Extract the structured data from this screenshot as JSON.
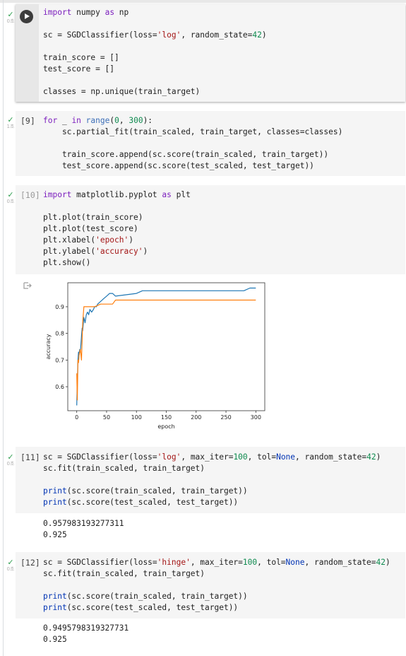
{
  "cells": [
    {
      "exec_label": "",
      "duration": "0초",
      "code_lines": [
        [
          [
            "k",
            "import"
          ],
          [
            "t",
            " numpy "
          ],
          [
            "k",
            "as"
          ],
          [
            "t",
            " np"
          ]
        ],
        [],
        [
          [
            "t",
            "sc = SGDClassifier(loss="
          ],
          [
            "s",
            "'log'"
          ],
          [
            "t",
            ", random_state="
          ],
          [
            "n",
            "42"
          ],
          [
            "t",
            ")"
          ]
        ],
        [],
        [
          [
            "t",
            "train_score = []"
          ]
        ],
        [
          [
            "t",
            "test_score = []"
          ]
        ],
        [],
        [
          [
            "t",
            "classes = np.unique(train_target)"
          ]
        ]
      ]
    },
    {
      "exec_label": "[9]",
      "duration": "1초",
      "code_lines": [
        [
          [
            "k",
            "for"
          ],
          [
            "t",
            " _ "
          ],
          [
            "k",
            "in"
          ],
          [
            "t",
            " "
          ],
          [
            "f",
            "range"
          ],
          [
            "t",
            "("
          ],
          [
            "n",
            "0"
          ],
          [
            "t",
            ", "
          ],
          [
            "n",
            "300"
          ],
          [
            "t",
            "):"
          ]
        ],
        [
          [
            "t",
            "    sc.partial_fit(train_scaled, train_target, classes=classes)"
          ]
        ],
        [],
        [
          [
            "t",
            "    train_score.append(sc.score(train_scaled, train_target))"
          ]
        ],
        [
          [
            "t",
            "    test_score.append(sc.score(test_scaled, test_target))"
          ]
        ]
      ]
    },
    {
      "exec_label": "[10]",
      "duration": "0초",
      "code_lines": [
        [
          [
            "k",
            "import"
          ],
          [
            "t",
            " matplotlib.pyplot "
          ],
          [
            "k",
            "as"
          ],
          [
            "t",
            " plt"
          ]
        ],
        [],
        [
          [
            "t",
            "plt.plot(train_score)"
          ]
        ],
        [
          [
            "t",
            "plt.plot(test_score)"
          ]
        ],
        [
          [
            "t",
            "plt.xlabel("
          ],
          [
            "s",
            "'epoch'"
          ],
          [
            "t",
            ")"
          ]
        ],
        [
          [
            "t",
            "plt.ylabel("
          ],
          [
            "s",
            "'accuracy'"
          ],
          [
            "t",
            ")"
          ]
        ],
        [
          [
            "t",
            "plt.show()"
          ]
        ]
      ]
    },
    {
      "exec_label": "[11]",
      "duration": "0초",
      "code_lines": [
        [
          [
            "t",
            "sc = SGDClassifier(loss="
          ],
          [
            "s",
            "'log'"
          ],
          [
            "t",
            ", max_iter="
          ],
          [
            "n",
            "100"
          ],
          [
            "t",
            ", tol="
          ],
          [
            "b",
            "None"
          ],
          [
            "t",
            ", random_state="
          ],
          [
            "n",
            "42"
          ],
          [
            "t",
            ")"
          ]
        ],
        [
          [
            "t",
            "sc.fit(train_scaled, train_target)"
          ]
        ],
        [],
        [
          [
            "b",
            "print"
          ],
          [
            "t",
            "(sc.score(train_scaled, train_target))"
          ]
        ],
        [
          [
            "b",
            "print"
          ],
          [
            "t",
            "(sc.score(test_scaled, test_target))"
          ]
        ]
      ],
      "output": [
        "0.957983193277311",
        "0.925"
      ]
    },
    {
      "exec_label": "[12]",
      "duration": "0초",
      "code_lines": [
        [
          [
            "t",
            "sc = SGDClassifier(loss="
          ],
          [
            "s",
            "'hinge'"
          ],
          [
            "t",
            ", max_iter="
          ],
          [
            "n",
            "100"
          ],
          [
            "t",
            ", tol="
          ],
          [
            "b",
            "None"
          ],
          [
            "t",
            ", random_state="
          ],
          [
            "n",
            "42"
          ],
          [
            "t",
            ")"
          ]
        ],
        [
          [
            "t",
            "sc.fit(train_scaled, train_target)"
          ]
        ],
        [],
        [
          [
            "b",
            "print"
          ],
          [
            "t",
            "(sc.score(train_scaled, train_target))"
          ]
        ],
        [
          [
            "b",
            "print"
          ],
          [
            "t",
            "(sc.score(test_scaled, test_target))"
          ]
        ]
      ],
      "output": [
        "0.9495798319327731",
        "0.925"
      ]
    }
  ],
  "output_icon": "output-arrow-icon",
  "chart_data": {
    "type": "line",
    "xlabel": "epoch",
    "ylabel": "accuracy",
    "xlim": [
      -15,
      315
    ],
    "ylim": [
      0.51,
      0.99
    ],
    "xticks": [
      0,
      50,
      100,
      150,
      200,
      250,
      300
    ],
    "yticks": [
      0.6,
      0.7,
      0.8,
      0.9
    ],
    "grid": false,
    "series": [
      {
        "color": "#1f77b4",
        "points": [
          [
            0,
            0.53
          ],
          [
            1,
            0.62
          ],
          [
            2,
            0.7
          ],
          [
            3,
            0.73
          ],
          [
            4,
            0.72
          ],
          [
            5,
            0.74
          ],
          [
            6,
            0.73
          ],
          [
            7,
            0.76
          ],
          [
            8,
            0.79
          ],
          [
            9,
            0.82
          ],
          [
            10,
            0.81
          ],
          [
            12,
            0.86
          ],
          [
            14,
            0.84
          ],
          [
            16,
            0.87
          ],
          [
            18,
            0.88
          ],
          [
            20,
            0.87
          ],
          [
            22,
            0.89
          ],
          [
            25,
            0.88
          ],
          [
            28,
            0.89
          ],
          [
            30,
            0.9
          ],
          [
            33,
            0.9
          ],
          [
            35,
            0.91
          ],
          [
            40,
            0.92
          ],
          [
            45,
            0.93
          ],
          [
            50,
            0.94
          ],
          [
            55,
            0.95
          ],
          [
            60,
            0.95
          ],
          [
            65,
            0.94
          ],
          [
            100,
            0.95
          ],
          [
            110,
            0.96
          ],
          [
            280,
            0.96
          ],
          [
            290,
            0.97
          ],
          [
            300,
            0.97
          ]
        ]
      },
      {
        "color": "#ff7f0e",
        "points": [
          [
            0,
            0.65
          ],
          [
            1,
            0.55
          ],
          [
            2,
            0.7
          ],
          [
            3,
            0.69
          ],
          [
            4,
            0.72
          ],
          [
            6,
            0.74
          ],
          [
            8,
            0.7
          ],
          [
            10,
            0.84
          ],
          [
            12,
            0.9
          ],
          [
            15,
            0.9
          ],
          [
            20,
            0.9
          ],
          [
            30,
            0.9
          ],
          [
            40,
            0.91
          ],
          [
            50,
            0.91
          ],
          [
            60,
            0.91
          ],
          [
            65,
            0.925
          ],
          [
            300,
            0.925
          ]
        ]
      }
    ]
  }
}
